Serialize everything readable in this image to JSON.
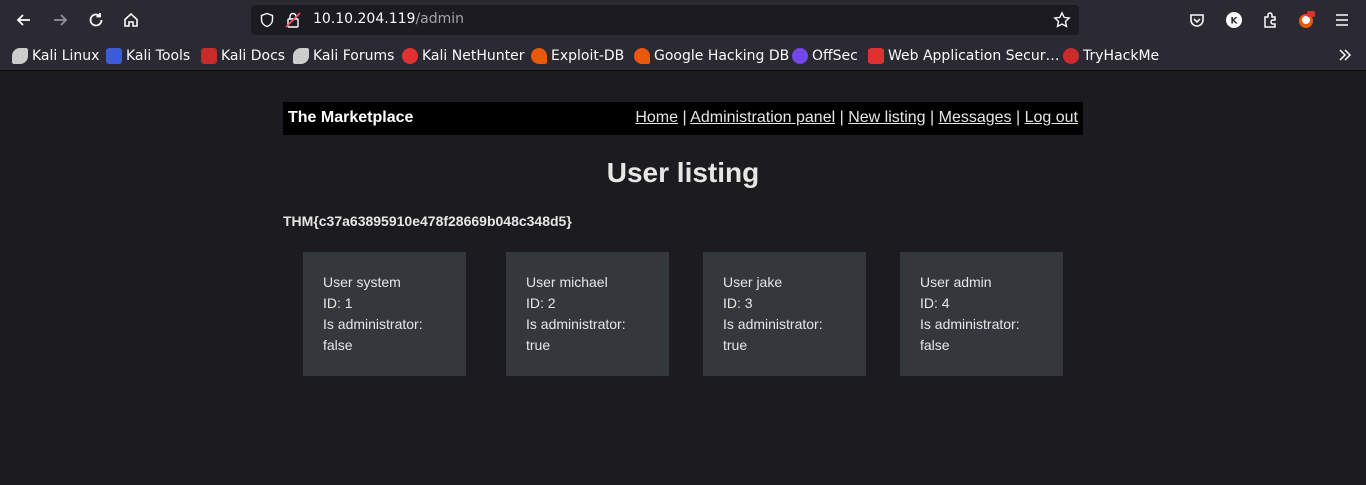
{
  "browser": {
    "url_host": "10.10.204.119",
    "url_path": "/admin",
    "bookmarks": [
      {
        "label": "Kali Linux",
        "icon": "kali-dragon-icon",
        "color": "#cccccc"
      },
      {
        "label": "Kali Tools",
        "icon": "kali-tools-icon",
        "color": "#3b5bdb"
      },
      {
        "label": "Kali Docs",
        "icon": "kali-docs-icon",
        "color": "#c92a2a"
      },
      {
        "label": "Kali Forums",
        "icon": "kali-forums-icon",
        "color": "#cccccc"
      },
      {
        "label": "Kali NetHunter",
        "icon": "nethunter-icon",
        "color": "#e03131"
      },
      {
        "label": "Exploit-DB",
        "icon": "exploit-db-icon",
        "color": "#e8590c"
      },
      {
        "label": "Google Hacking DB",
        "icon": "ghdb-icon",
        "color": "#e8590c"
      },
      {
        "label": "OffSec",
        "icon": "offsec-icon",
        "color": "#7048e8"
      },
      {
        "label": "Web Application Secur…",
        "icon": "web-sec-icon",
        "color": "#e03131"
      },
      {
        "label": "TryHackMe",
        "icon": "tryhackme-icon",
        "color": "#c92a2a"
      }
    ]
  },
  "site": {
    "brand": "The Marketplace",
    "nav": {
      "home": "Home",
      "admin": "Administration panel",
      "new_listing": "New listing",
      "messages": "Messages",
      "logout": "Log out",
      "sep": "|"
    },
    "heading": "User listing",
    "flag": "THM{c37a63895910e478f28669b048c348d5}",
    "users": [
      {
        "name": "User system",
        "id": "ID: 1",
        "admin_label": "Is administrator:",
        "admin_value": "false"
      },
      {
        "name": "User michael",
        "id": "ID: 2",
        "admin_label": "Is administrator:",
        "admin_value": "true"
      },
      {
        "name": "User jake",
        "id": "ID: 3",
        "admin_label": "Is administrator:",
        "admin_value": "true"
      },
      {
        "name": "User admin",
        "id": "ID: 4",
        "admin_label": "Is administrator:",
        "admin_value": "false"
      }
    ]
  }
}
